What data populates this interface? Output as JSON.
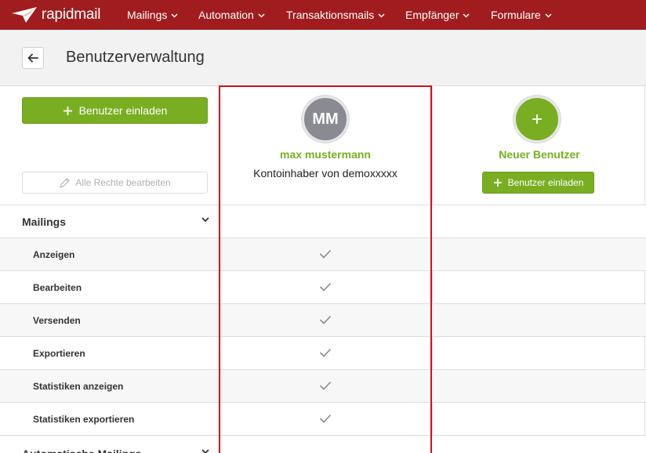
{
  "nav": {
    "brand": "rapidmail",
    "items": [
      {
        "label": "Mailings"
      },
      {
        "label": "Automation"
      },
      {
        "label": "Transaktionsmails"
      },
      {
        "label": "Empfänger"
      },
      {
        "label": "Formulare"
      }
    ]
  },
  "header": {
    "title": "Benutzerverwaltung"
  },
  "left_panel": {
    "invite_label": "Benutzer einladen",
    "edit_all_label": "Alle Rechte bearbeiten"
  },
  "users": [
    {
      "initials": "MM",
      "name": "max mustermann",
      "role": "Kontoinhaber von demoxxxxx"
    }
  ],
  "new_user": {
    "title": "Neuer Benutzer",
    "invite_label": "Benutzer einladen"
  },
  "permissions": {
    "sections": [
      {
        "label": "Mailings",
        "items": [
          {
            "label": "Anzeigen",
            "granted": true
          },
          {
            "label": "Bearbeiten",
            "granted": true
          },
          {
            "label": "Versenden",
            "granted": true
          },
          {
            "label": "Exportieren",
            "granted": true
          },
          {
            "label": "Statistiken anzeigen",
            "granted": true
          },
          {
            "label": "Statistiken exportieren",
            "granted": true
          }
        ]
      },
      {
        "label": "Automatische Mailings",
        "items": []
      }
    ]
  },
  "colors": {
    "nav_bg": "#a01c1e",
    "accent_green": "#79ae22",
    "highlight_red": "#d0101a",
    "avatar_grey": "#8a8a92"
  }
}
